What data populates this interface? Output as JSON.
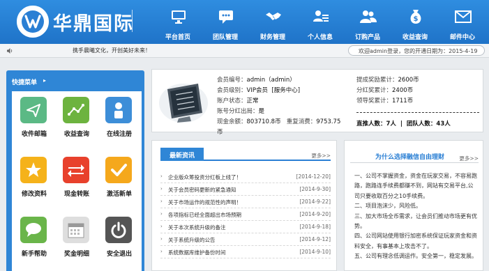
{
  "header": {
    "brand": "华鼎国际",
    "nav": [
      {
        "label": "平台首页",
        "icon": "monitor-icon"
      },
      {
        "label": "团队管理",
        "icon": "chat-icon"
      },
      {
        "label": "财务管理",
        "icon": "handshake-icon"
      },
      {
        "label": "个人信息",
        "icon": "user-card-icon"
      },
      {
        "label": "订购产品",
        "icon": "users-icon"
      },
      {
        "label": "收益查询",
        "icon": "money-bag-icon"
      },
      {
        "label": "邮件中心",
        "icon": "mail-icon"
      }
    ]
  },
  "statusbar": {
    "ticker": "携手晨曦文化，开创美好未来！",
    "welcome": "欢迎admin登录，您的开通日期为：2015-4-19"
  },
  "sidebar": {
    "title": "快捷菜单",
    "items": [
      {
        "label": "收件邮箱",
        "icon": "send-icon",
        "color": "#5bb985"
      },
      {
        "label": "收益查询",
        "icon": "chart-line-icon",
        "color": "#6db33f"
      },
      {
        "label": "在线注册",
        "icon": "person-icon",
        "color": "#3d8ed8"
      },
      {
        "label": "修改资料",
        "icon": "star-icon",
        "color": "#f5b21a"
      },
      {
        "label": "现金转账",
        "icon": "transfer-icon",
        "color": "#e8412c"
      },
      {
        "label": "激活新单",
        "icon": "check-icon",
        "color": "#f5a81c"
      },
      {
        "label": "新手帮助",
        "icon": "speech-bubble-icon",
        "color": "#6ab54a"
      },
      {
        "label": "奖金明细",
        "icon": "calendar-icon",
        "color": "#dedede"
      },
      {
        "label": "安全退出",
        "icon": "power-icon",
        "color": "#555555"
      }
    ]
  },
  "account": {
    "member_no_label": "会员编号：",
    "member_no": "admin（admin）",
    "level_label": "会员级别：",
    "level": "VIP会员",
    "level_extra": "[服务中心]",
    "status_label": "账户状态：",
    "status": "正常",
    "dividend_label": "账号分红出局：",
    "dividend": "是",
    "cash_label": "现金余额：",
    "cash": "803710.8币",
    "repeat_label": "重复消费：",
    "repeat": "9753.75",
    "repeat_unit": "币",
    "stat1_label": "提成奖励累计：",
    "stat1": "2600币",
    "stat2_label": "分红奖累计：",
    "stat2": "2400币",
    "stat3_label": "领导奖累计：",
    "stat3": "1711币",
    "direct_label": "直推人数：",
    "direct": "7人",
    "team_label": "团队人数：",
    "team": "43人",
    "sep": "|"
  },
  "news": {
    "tab": "最新资讯",
    "more": "更多>>",
    "items": [
      {
        "title": "企业版众筹投资分红板上线了！",
        "date": "[2014-12-20]"
      },
      {
        "title": "关于会员密码更新的紧急通知",
        "date": "[2014-9-30]"
      },
      {
        "title": "关于市场运作的规范性的声明！",
        "date": "[2014-9-22]"
      },
      {
        "title": "各项指标已经全面超出市场预期",
        "date": "[2014-9-20]"
      },
      {
        "title": "关于本次系统升级的备注",
        "date": "[2014-9-18]"
      },
      {
        "title": "关于系统升级的公告",
        "date": "[2014-9-12]"
      },
      {
        "title": "系统数据库维护备份时间",
        "date": "[2014-9-10]"
      }
    ]
  },
  "why": {
    "title": "为什么选择融信自由理财",
    "more": "更多>>",
    "paras": [
      "一、公司不掌握资金，资金在玩家交易，不容易跑路，跑路连手续费都赚不到，网站有交易平台,公司只要收取百分之10手续费。",
      "二、项目泡沫少，风险低。",
      "三、加大市场全币需求，让会员们推动市场更有优势。",
      "四、公司网站使用银行加密系统保证玩家资金和资料安全，有事基本上攻击不了。",
      "五、公司有理念低调运作。安全第一，稳定发展。"
    ]
  }
}
